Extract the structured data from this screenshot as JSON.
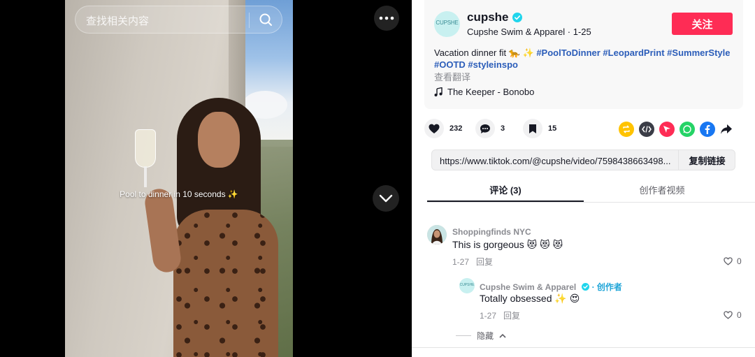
{
  "search": {
    "placeholder": "查找相关内容"
  },
  "video": {
    "caption": "Pool to dinner in 10 seconds ✨"
  },
  "author": {
    "avatar_text": "CUPSHE",
    "username": "cupshe",
    "nickname_date": "Cupshe Swim & Apparel · 1-25",
    "follow_label": "关注"
  },
  "description": {
    "text": "Vacation dinner fit 🐆 ✨ ",
    "hashtags": [
      "#PoolToDinner",
      "#LeopardPrint",
      "#SummerStyle",
      "#OOTD",
      "#styleinspo"
    ],
    "translate_label": "查看翻译"
  },
  "music": {
    "title": "The Keeper - Bonobo"
  },
  "stats": {
    "likes": "232",
    "comments": "3",
    "saves": "15"
  },
  "share_icons": [
    "repost-icon",
    "embed-icon",
    "send-icon",
    "whatsapp-icon",
    "facebook-icon",
    "share-arrow-icon"
  ],
  "link": {
    "url": "https://www.tiktok.com/@cupshe/video/7598438663498...",
    "copy_label": "复制链接"
  },
  "tabs": [
    {
      "label": "评论 (3)",
      "active": true
    },
    {
      "label": "创作者视频",
      "active": false
    }
  ],
  "comments": [
    {
      "name": "Shoppingfinds NYC",
      "text": "This is gorgeous 😻 😻 😻",
      "date": "1-27",
      "reply_label": "回复",
      "likes": "0"
    },
    {
      "name": "Cupshe Swim & Apparel",
      "creator_label": "· 创作者",
      "avatar_text": "CUPSHE",
      "text": "Totally obsessed ✨ 😍",
      "date": "1-27",
      "reply_label": "回复",
      "likes": "0"
    }
  ],
  "hide_label": "隐藏",
  "colors": {
    "follow": "#fe2c55",
    "hashtag": "#2b5db9",
    "verified": "#20d5ec",
    "creator": "#20a5d8"
  }
}
